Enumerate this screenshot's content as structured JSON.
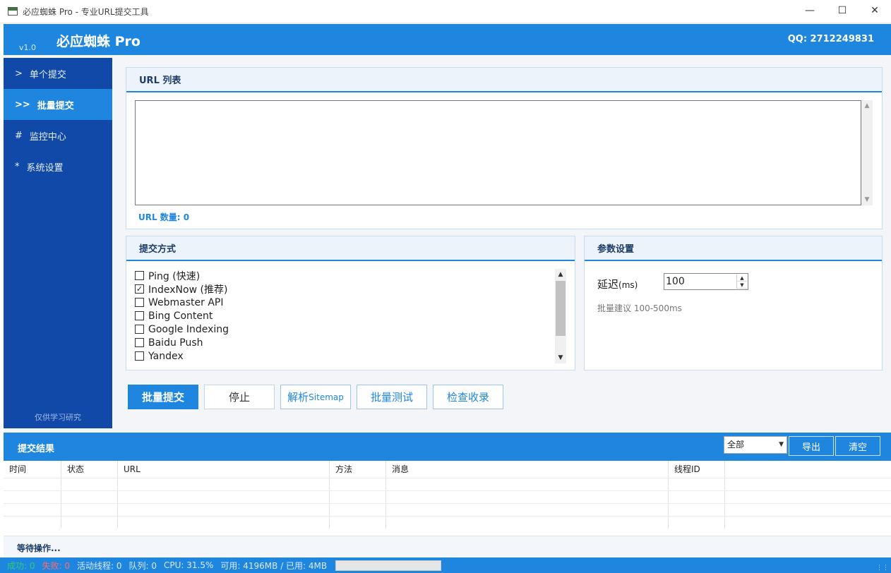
{
  "window": {
    "title": "必应蜘蛛 Pro - 专业URL提交工具",
    "controls": [
      "minimize",
      "maximize",
      "close"
    ]
  },
  "header": {
    "version": "v1.0",
    "app_name": "必应蜘蛛 Pro",
    "qq": "QQ: 2712249831"
  },
  "sidebar": {
    "items": [
      {
        "mark": ">",
        "label": "单个提交",
        "active": false
      },
      {
        "mark": ">>",
        "label": "批量提交",
        "active": true
      },
      {
        "mark": "#",
        "label": "监控中心",
        "active": false
      },
      {
        "mark": "*",
        "label": "系统设置",
        "active": false
      }
    ],
    "footer": "仅供学习研究"
  },
  "url_panel": {
    "title": "URL 列表",
    "textarea_value": "",
    "count_label": "URL 数量: 0"
  },
  "method_panel": {
    "title": "提交方式",
    "methods": [
      {
        "label": "Ping (快速)",
        "checked": false
      },
      {
        "label": "IndexNow (推荐)",
        "checked": true
      },
      {
        "label": "Webmaster API",
        "checked": false
      },
      {
        "label": "Bing Content",
        "checked": false
      },
      {
        "label": "Google Indexing",
        "checked": false
      },
      {
        "label": "Baidu Push",
        "checked": false
      },
      {
        "label": "Yandex",
        "checked": false
      }
    ]
  },
  "params_panel": {
    "title": "参数设置",
    "delay_label": "延迟",
    "delay_unit": "(ms)",
    "delay_value": "100",
    "hint": "批量建议 100-500ms"
  },
  "actions": {
    "batch_submit": "批量提交",
    "stop": "停止",
    "parse_prefix": "解析",
    "parse_suffix": "Sitemap",
    "batch_test": "批量测试",
    "check_index": "检查收录"
  },
  "results": {
    "title": "提交结果",
    "filter_value": "全部",
    "export": "导出",
    "clear": "清空",
    "columns": [
      "时间",
      "状态",
      "URL",
      "方法",
      "消息",
      "线程ID"
    ],
    "rows": []
  },
  "status_message": "等待操作...",
  "statusbar": {
    "success": "成功: 0",
    "fail": "失败: 0",
    "active_threads": "活动线程: 0",
    "queue": "队列: 0",
    "cpu": "CPU: 31.5%",
    "memory": "可用: 4196MB / 已用: 4MB",
    "progress": 0,
    "colors": {
      "success": "#2ecc71",
      "fail": "#ff6b6b",
      "normal": "#dbe9fb"
    }
  }
}
